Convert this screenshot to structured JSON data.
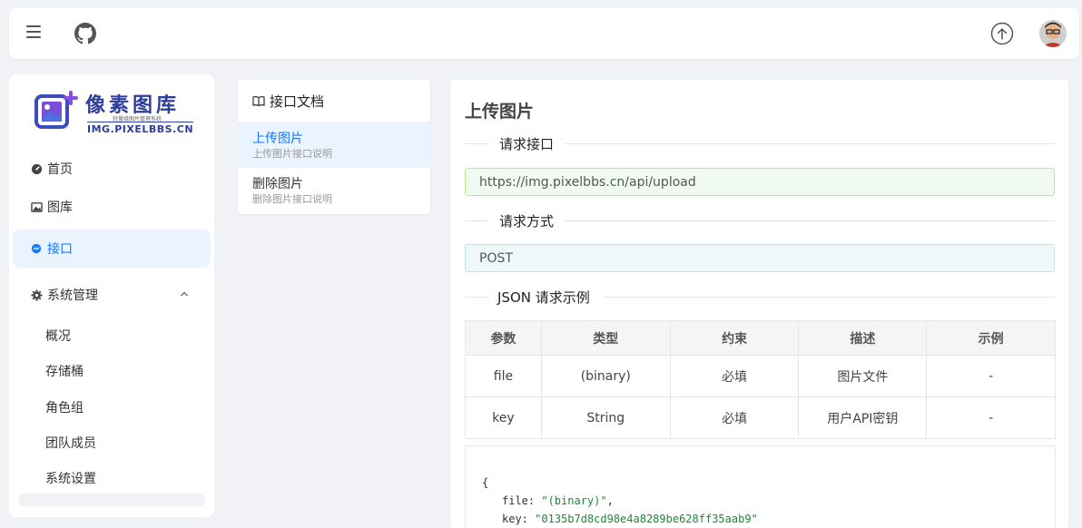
{
  "header": {
    "menu_icon": "hamburger-icon",
    "github_icon": "github-icon",
    "upload_icon": "upload-circle-icon",
    "avatar_icon": "user-avatar"
  },
  "logo": {
    "title": "像素图库",
    "subtitle": "轻量级图片管理系统",
    "domain": "IMG.PIXELBBS.CN"
  },
  "sidebar": {
    "items": [
      {
        "label": "首页",
        "icon": "dashboard-icon"
      },
      {
        "label": "图库",
        "icon": "image-icon"
      },
      {
        "label": "接口",
        "icon": "api-icon",
        "active": true
      },
      {
        "label": "系统管理",
        "icon": "gear-icon",
        "expanded": true
      }
    ],
    "sub_items": [
      "概况",
      "存储桶",
      "角色组",
      "团队成员",
      "系统设置"
    ]
  },
  "doc_panel": {
    "title": "接口文档",
    "icon": "book-icon",
    "items": [
      {
        "title": "上传图片",
        "desc": "上传图片接口说明",
        "active": true
      },
      {
        "title": "删除图片",
        "desc": "删除图片接口说明"
      }
    ]
  },
  "main": {
    "title": "上传图片",
    "section_endpoint": "请求接口",
    "endpoint_url": "https://img.pixelbbs.cn/api/upload",
    "section_method": "请求方式",
    "method": "POST",
    "section_example": "JSON 请求示例",
    "table": {
      "headers": [
        "参数",
        "类型",
        "约束",
        "描述",
        "示例"
      ],
      "rows": [
        [
          "file",
          "(binary)",
          "必填",
          "图片文件",
          "-"
        ],
        [
          "key",
          "String",
          "必填",
          "用户API密钥",
          "-"
        ]
      ]
    },
    "code": {
      "open": "{",
      "k1": "file:",
      "v1": "\"(binary)\"",
      "c1": ",",
      "k2": "key:",
      "v2": "\"0135b7d8cd98e4a8289be628ff35aab9\""
    }
  },
  "colors": {
    "accent": "#1677ff",
    "active_bg": "#eaf4ff",
    "success_border": "#b7eb8f",
    "info_bg": "#eef8fb"
  }
}
